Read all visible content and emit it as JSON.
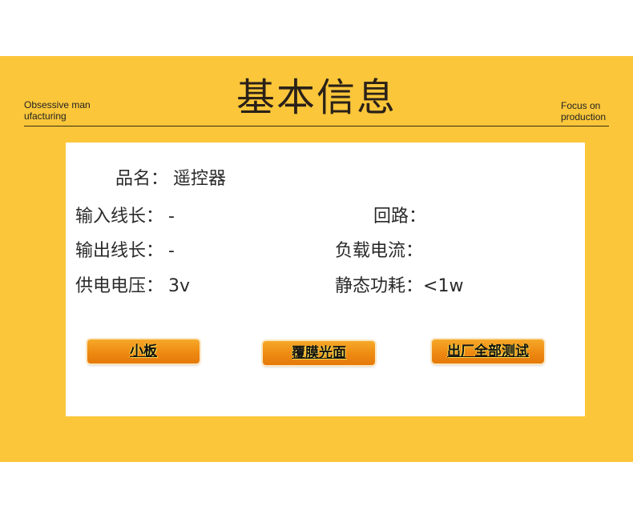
{
  "header": {
    "title": "基本信息",
    "left_tag": "Obsessive man ufacturing",
    "right_tag": "Focus on production"
  },
  "fields": {
    "product_name": {
      "label": "品名：",
      "value": "遥控器"
    },
    "input_wire_length": {
      "label": "输入线长：",
      "value": "-"
    },
    "circuit": {
      "label": "回路：",
      "value": ""
    },
    "output_wire_length": {
      "label": "输出线长：",
      "value": "-"
    },
    "load_current": {
      "label": "负载电流：",
      "value": ""
    },
    "supply_voltage": {
      "label": "供电电压：",
      "value": "3v"
    },
    "standby_power": {
      "label": "静态功耗：",
      "value": "<1w"
    }
  },
  "buttons": {
    "small_board": "小板",
    "film_gloss": "覆膜光面",
    "factory_full_test": "出厂全部测试"
  },
  "colors": {
    "band": "#fbc63a",
    "button_top": "#f6a928",
    "button_bottom": "#e57a0a"
  }
}
